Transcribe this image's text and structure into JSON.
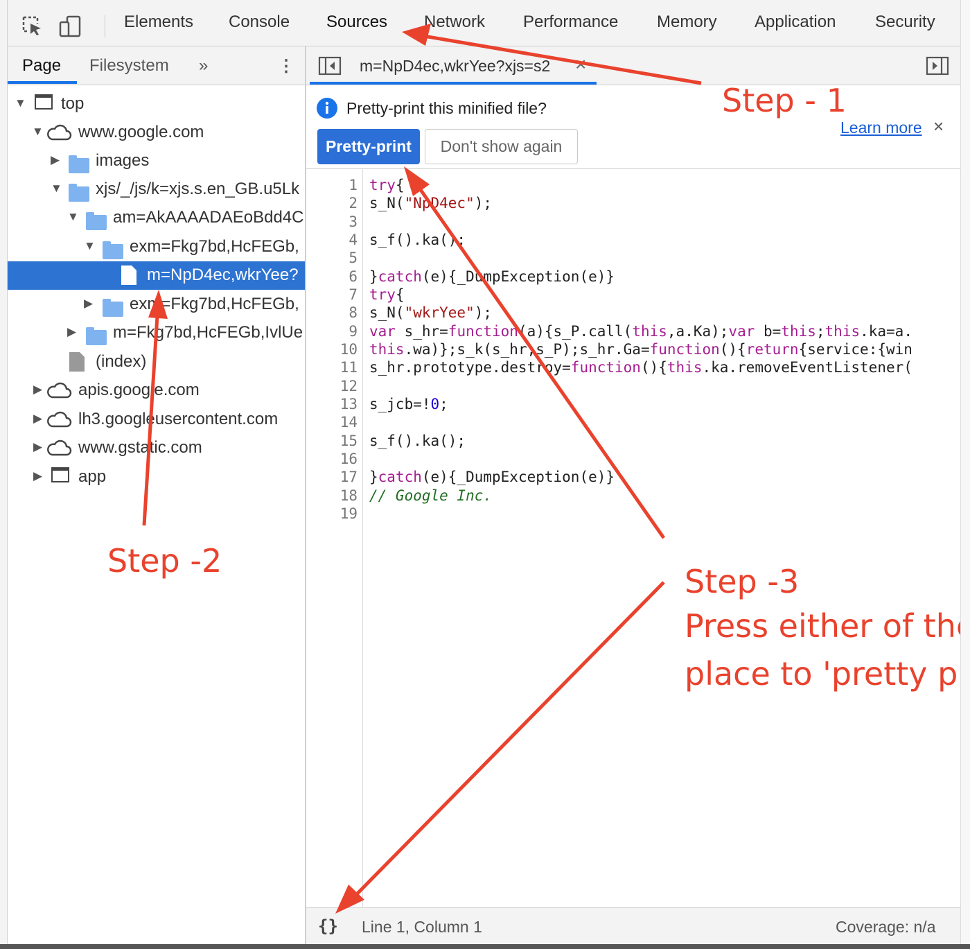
{
  "toolbar": {
    "inspect_icon": "inspect-element-icon",
    "device_icon": "device-toolbar-icon",
    "tabs": [
      "Elements",
      "Console",
      "Sources",
      "Network",
      "Performance",
      "Memory",
      "Application",
      "Security"
    ],
    "active_tab": "Sources"
  },
  "navigator": {
    "tabs": [
      "Page",
      "Filesystem"
    ],
    "more_icon": "»",
    "menu_icon": "⋮",
    "tree": [
      {
        "label": "top",
        "icon": "frame"
      },
      {
        "label": "www.google.com",
        "icon": "cloud"
      },
      {
        "label": "images",
        "icon": "folder"
      },
      {
        "label": "xjs/_/js/k=xjs.s.en_GB.u5Lk",
        "icon": "folder"
      },
      {
        "label": "am=AkAAAADAEoBdd4C",
        "icon": "folder"
      },
      {
        "label": "exm=Fkg7bd,HcFEGb,",
        "icon": "folder"
      },
      {
        "label": "m=NpD4ec,wkrYee?",
        "icon": "file"
      },
      {
        "label": "exm=Fkg7bd,HcFEGb,",
        "icon": "folder"
      },
      {
        "label": "m=Fkg7bd,HcFEGb,IvlUe",
        "icon": "folder"
      },
      {
        "label": "(index)",
        "icon": "file"
      },
      {
        "label": "apis.google.com",
        "icon": "cloud"
      },
      {
        "label": "lh3.googleusercontent.com",
        "icon": "cloud"
      },
      {
        "label": "www.gstatic.com",
        "icon": "cloud"
      },
      {
        "label": "app",
        "icon": "frame"
      }
    ]
  },
  "editor": {
    "file_tab": "m=NpD4ec,wkrYee?xjs=s2",
    "close_glyph": "×",
    "infobar": {
      "message": "Pretty-print this minified file?",
      "learn_more": "Learn more",
      "close_glyph": "×",
      "pretty_print_button": "Pretty-print",
      "dont_show_button": "Don't show again"
    },
    "line_numbers": [
      "1",
      "2",
      "3",
      "4",
      "5",
      "6",
      "7",
      "8",
      "9",
      "10",
      "11",
      "12",
      "13",
      "14",
      "15",
      "16",
      "17",
      "18",
      "19"
    ]
  },
  "status_bar": {
    "format_button": "{}",
    "position": "Line 1, Column 1",
    "coverage": "Coverage: n/a"
  },
  "annotations": {
    "step1": "Step - 1",
    "step2": "Step -2",
    "step3_title": "Step -3",
    "step3_line1": "Press either of the",
    "step3_line2": "place to 'pretty pri"
  },
  "colors": {
    "accent": "#1a73e8",
    "annotation": "#e9422d",
    "selected_row": "#2c73d2"
  }
}
